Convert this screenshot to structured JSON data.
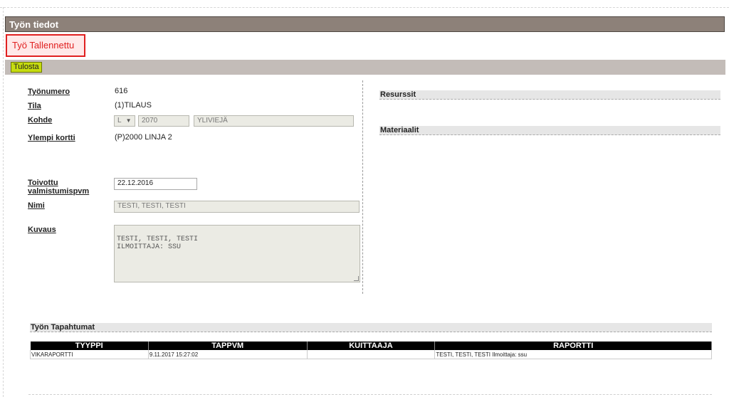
{
  "header": {
    "title": "Työn tiedot"
  },
  "status": {
    "saved_message": "Työ Tallennettu"
  },
  "toolbar": {
    "print_label": "Tulosta"
  },
  "form": {
    "work_number": {
      "label": "Työnumero",
      "value": "616"
    },
    "state": {
      "label": "Tila",
      "value": "(1)TILAUS"
    },
    "target": {
      "label": "Kohde",
      "type_select": "L",
      "code": "2070",
      "name": "YLIVIEJÄ"
    },
    "parent_card": {
      "label": "Ylempi kortti",
      "value": "(P)2000 LINJA 2"
    },
    "desired_date": {
      "label_line1": "Toivottu",
      "label_line2": "valmistumispvm",
      "value": "22.12.2016"
    },
    "name": {
      "label": "Nimi",
      "value": "TESTI, TESTI, TESTI"
    },
    "description": {
      "label": "Kuvaus",
      "value": "TESTI, TESTI, TESTI\nILMOITTAJA: SSU"
    }
  },
  "right_panel": {
    "resources_title": "Resurssit",
    "materials_title": "Materiaalit"
  },
  "events": {
    "title": "Työn Tapahtumat",
    "columns": [
      "TYYPPI",
      "TAPPVM",
      "KUITTAAJA",
      "RAPORTTI"
    ],
    "rows": [
      [
        "VIKARAPORTTI",
        "9.11.2017 15:27:02",
        "",
        "TESTI, TESTI, TESTI Ilmoittaja: ssu"
      ]
    ]
  }
}
